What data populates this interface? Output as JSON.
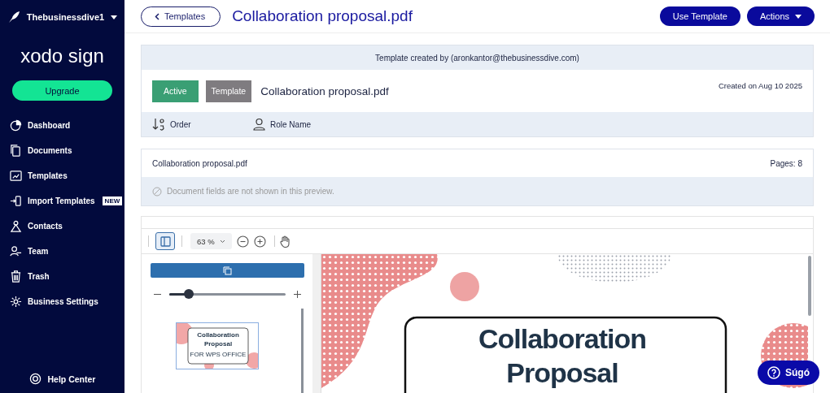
{
  "sidebar": {
    "account": "Thebusinessdive1",
    "logo": "xodo sign",
    "upgrade_button": "Upgrade",
    "items": [
      {
        "label": "Dashboard",
        "kind": "dashboard"
      },
      {
        "label": "Documents",
        "kind": "documents"
      },
      {
        "label": "Templates",
        "kind": "templates"
      },
      {
        "label": "Import Templates",
        "kind": "import",
        "badge": "NEW"
      },
      {
        "label": "Contacts",
        "kind": "contacts"
      },
      {
        "label": "Team",
        "kind": "team"
      },
      {
        "label": "Trash",
        "kind": "trash"
      },
      {
        "label": "Business Settings",
        "kind": "settings"
      }
    ],
    "help": "Help Center"
  },
  "header": {
    "back_button": "Templates",
    "title": "Collaboration proposal.pdf",
    "use_button": "Use Template",
    "actions_button": "Actions"
  },
  "template_card": {
    "created_by": "Template created by (aronkantor@thebusinessdive.com)",
    "status_badge": "Active",
    "type_badge": "Template",
    "name": "Collaboration proposal.pdf",
    "created_on": "Created on Aug 10 2025",
    "columns": [
      "Order",
      "Role Name"
    ]
  },
  "preview_card": {
    "file_name": "Collaboration proposal.pdf",
    "pages": "Pages: 8",
    "notice": "Document fields are not shown in this preview."
  },
  "viewer": {
    "panel_toggle": {
      "selected": true
    },
    "zoom": "63 %",
    "thumbnail_size": {
      "level": 0.17
    },
    "thumbnail": {
      "lines": [
        "Collaboration",
        "Proposal",
        "FOR WPS OFFICE"
      ]
    },
    "page": {
      "title_lines": [
        "Collaboration",
        "Proposal"
      ]
    }
  },
  "help_button": "Súgó"
}
